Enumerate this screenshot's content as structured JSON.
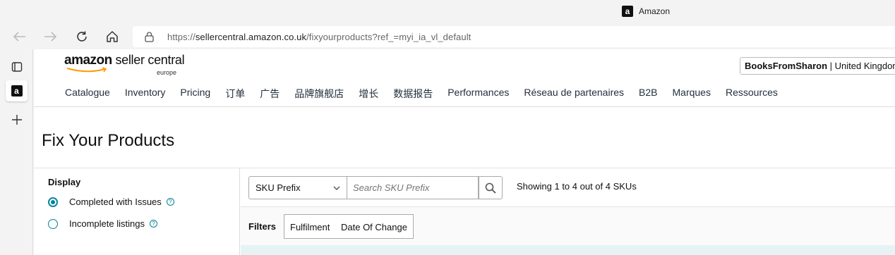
{
  "browser": {
    "tab_title": "Amazon",
    "url_prefix": "https://",
    "url_domain": "sellercentral.amazon.co.uk",
    "url_path": "/fixyourproducts?ref_=myi_ia_vl_default"
  },
  "brand": {
    "amazon": "amazon",
    "seller_central": " seller central",
    "region": "europe"
  },
  "account": {
    "store": "BooksFromSharon",
    "separator": " | ",
    "marketplace": "United Kingdom"
  },
  "nav": [
    "Catalogue",
    "Inventory",
    "Pricing",
    "订单",
    "广告",
    "品牌旗舰店",
    "增长",
    "数据报告",
    "Performances",
    "Réseau de partenaires",
    "B2B",
    "Marques",
    "Ressources"
  ],
  "page_title": "Fix Your Products",
  "sidebar": {
    "heading": "Display",
    "options": [
      {
        "label": "Completed with Issues",
        "selected": true
      },
      {
        "label": "Incomplete listings",
        "selected": false
      }
    ]
  },
  "search": {
    "select_value": "SKU Prefix",
    "placeholder": "Search SKU Prefix",
    "showing": "Showing 1 to 4 out of 4 SKUs"
  },
  "filters": {
    "label": "Filters",
    "buttons": [
      "Fulfilment",
      "Date Of Change"
    ]
  },
  "colors": {
    "accent": "#008296",
    "text": "#0f1111"
  }
}
